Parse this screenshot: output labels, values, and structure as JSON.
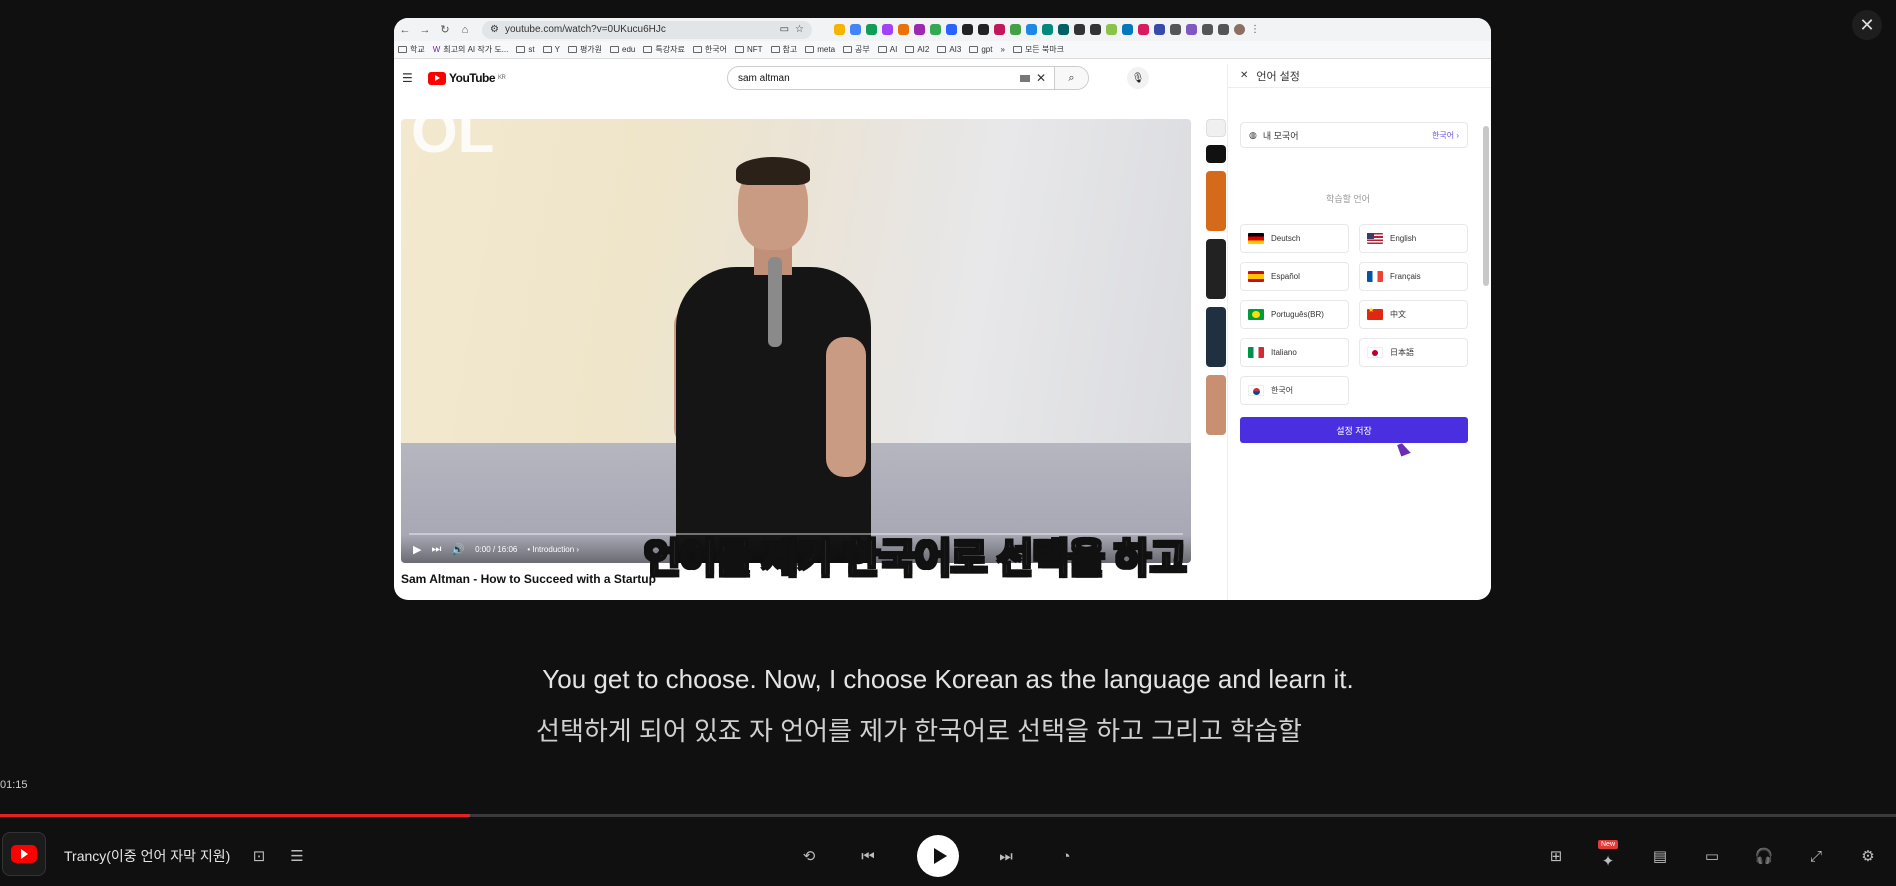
{
  "browser": {
    "url": "youtube.com/watch?v=0UKucu6HJc",
    "bookmarks": [
      "학교",
      "최고의 AI 작가 도...",
      "st",
      "Y",
      "평가원",
      "edu",
      "특강자료",
      "한국어",
      "NFT",
      "참고",
      "meta",
      "공부",
      "AI",
      "AI2",
      "AI3",
      "gpt",
      "»",
      "모든 북마크"
    ]
  },
  "youtube": {
    "logo": "YouTube",
    "region": "KR",
    "search_value": "sam altman",
    "video_time": "0:00 / 16:06",
    "chapter": "Introduction",
    "burned_caption": "언어를 제가 한국어로 선택을 하고",
    "video_title": "Sam Altman - How to Succeed with a Startup",
    "overlay_text": "OL"
  },
  "language_panel": {
    "title": "언어 설정",
    "native_label": "내 모국어",
    "native_value": "한국어",
    "learn_label": "학습할 언어",
    "languages": [
      {
        "name": "Deutsch",
        "flag": "de"
      },
      {
        "name": "English",
        "flag": "us"
      },
      {
        "name": "Español",
        "flag": "es"
      },
      {
        "name": "Français",
        "flag": "fr"
      },
      {
        "name": "Português(BR)",
        "flag": "br"
      },
      {
        "name": "中文",
        "flag": "cn"
      },
      {
        "name": "Italiano",
        "flag": "it"
      },
      {
        "name": "日本語",
        "flag": "jp"
      },
      {
        "name": "한국어",
        "flag": "kr"
      }
    ],
    "save_label": "설정 저장"
  },
  "subtitles": {
    "english": "You get to choose. Now, I choose Korean as the language and learn it.",
    "korean": "선택하게 되어 있죠 자 언어를 제가 한국어로 선택을 하고 그리고 학습할"
  },
  "player": {
    "elapsed": "01:15",
    "progress": 0.248,
    "app_title": "Trancy(이중 언어 자막 지원)",
    "new_badge": "New"
  },
  "colors": {
    "accent": "#4a2fe0",
    "progress": "#e52222",
    "youtube_red": "#ff0000"
  }
}
